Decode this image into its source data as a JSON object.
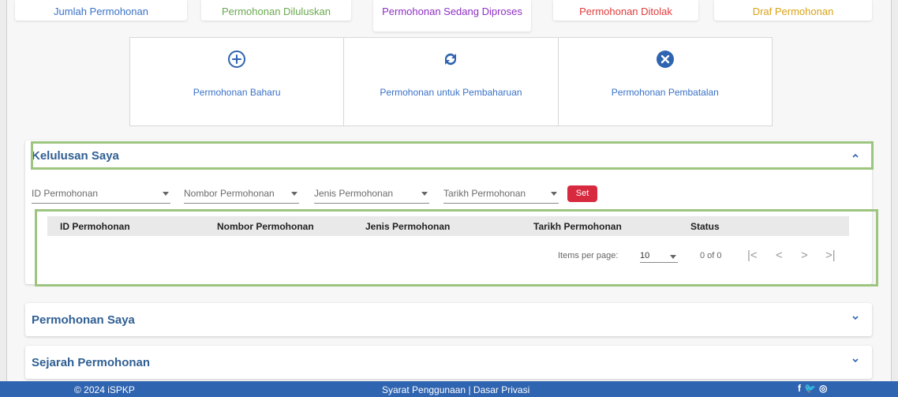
{
  "stats": [
    {
      "label": "Jumlah Permohonan",
      "color": "#3a72c8"
    },
    {
      "label": "Permohonan Diluluskan",
      "color": "#6aa84f"
    },
    {
      "label": "Permohonan Sedang Diproses",
      "color": "#8e2ec4"
    },
    {
      "label": "Permohonan Ditolak",
      "color": "#e03b3b"
    },
    {
      "label": "Draf Permohonan",
      "color": "#d9a216"
    }
  ],
  "actions": [
    {
      "label": "Permohonan Baharu",
      "icon": "plus-circle-icon"
    },
    {
      "label": "Permohonan untuk Pembaharuan",
      "icon": "refresh-icon"
    },
    {
      "label": "Permohonan Pembatalan",
      "icon": "cancel-circle-icon"
    }
  ],
  "kelulusan": {
    "title": "Kelulusan Saya",
    "filters": [
      "ID Permohonan",
      "Nombor Permohonan",
      "Jenis Permohonan",
      "Tarikh Permohonan"
    ],
    "set_label": "Set",
    "columns": [
      "ID Permohonan",
      "Nombor Permohonan",
      "Jenis Permohonan",
      "Tarikh Permohonan",
      "Status"
    ],
    "paginator": {
      "label": "Items per page:",
      "page_size": "10",
      "range": "0 of 0"
    }
  },
  "permohonan": {
    "title": "Permohonan Saya"
  },
  "sejarah": {
    "title": "Sejarah Permohonan"
  },
  "footer": {
    "copyright": "© 2024 iSPKP",
    "terms": "Syarat Penggunaan",
    "separator": "|",
    "privacy": "Dasar Privasi",
    "social": [
      "f",
      "🐦",
      "◎"
    ]
  },
  "colors": {
    "accent": "#2f64b0",
    "danger": "#d82a3f",
    "highlight": "#9dc57f"
  }
}
